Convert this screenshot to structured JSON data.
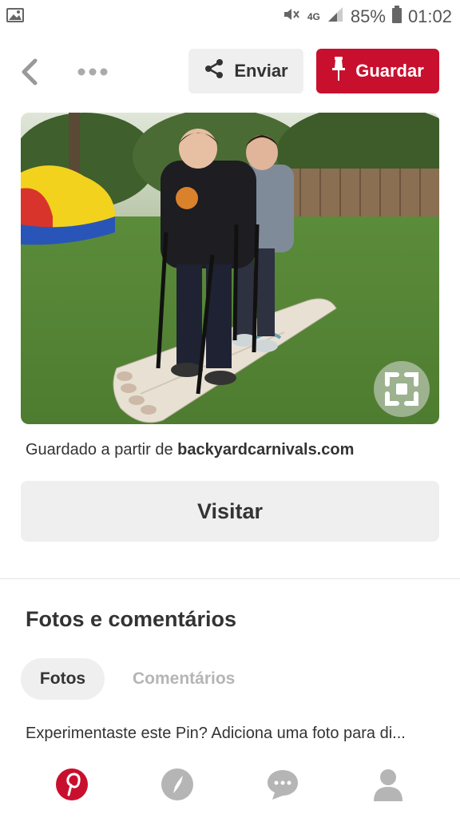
{
  "status_bar": {
    "battery_percent": "85%",
    "time": "01:02",
    "network": "4G",
    "icons": [
      "image-icon",
      "mute-icon",
      "signal-icon",
      "battery-icon"
    ]
  },
  "top_bar": {
    "share_label": "Enviar",
    "save_label": "Guardar",
    "icons": [
      "back-arrow-icon",
      "more-dots-icon",
      "share-icon",
      "pin-icon"
    ]
  },
  "pin": {
    "image_alt": "two people on giant foam skis in a backyard",
    "saved_from_prefix": "Guardado a partir de ",
    "source_domain": "backyardcarnivals.com",
    "visit_label": "Visitar"
  },
  "comments_section": {
    "title": "Fotos e comentários",
    "tabs": [
      {
        "label": "Fotos",
        "active": true
      },
      {
        "label": "Comentários",
        "active": false
      }
    ],
    "prompt": "Experimentaste este Pin? Adiciona uma foto para di..."
  },
  "bottom_nav": {
    "items": [
      "home-pinterest-icon",
      "explore-compass-icon",
      "messages-icon",
      "profile-icon"
    ]
  },
  "colors": {
    "brand_red": "#c8102e",
    "button_gray": "#efefef",
    "inactive_nav": "#b5b5b5"
  }
}
